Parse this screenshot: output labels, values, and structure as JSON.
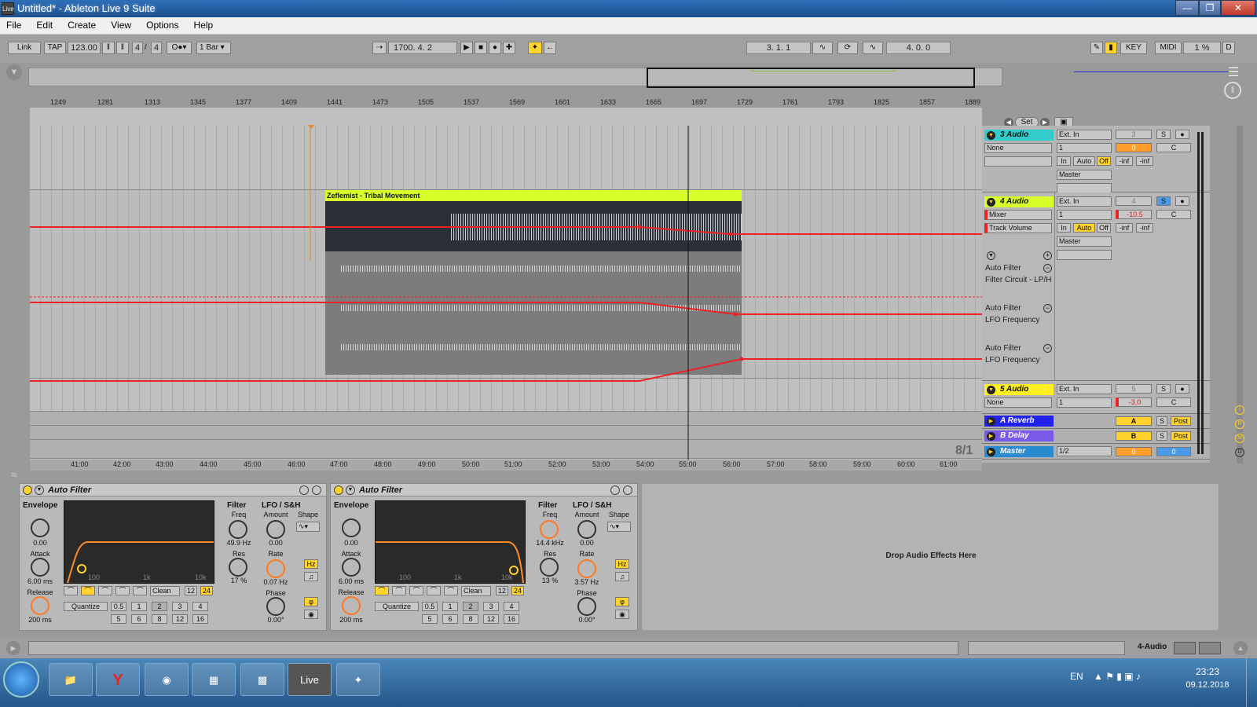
{
  "window": {
    "app_icon": "Live",
    "title": "Untitled* - Ableton Live 9 Suite"
  },
  "menu": [
    "File",
    "Edit",
    "Create",
    "View",
    "Options",
    "Help"
  ],
  "control_bar": {
    "link": "Link",
    "tap": "TAP",
    "tempo": "123.00",
    "signature_num": "4",
    "signature_den": "4",
    "quantize": "1 Bar",
    "position": "1700.   4.   2",
    "loop_start": "3.   1.   1",
    "loop_length": "4.   0.   0",
    "key": "KEY",
    "midi": "MIDI",
    "cpu": "1 %",
    "d": "D"
  },
  "ruler_bars": [
    "1249",
    "1281",
    "1313",
    "1345",
    "1377",
    "1409",
    "1441",
    "1473",
    "1505",
    "1537",
    "1569",
    "1601",
    "1633",
    "1665",
    "1697",
    "1729",
    "1761",
    "1793",
    "1825",
    "1857",
    "1889"
  ],
  "time_ruler": [
    "41:00",
    "42:00",
    "43:00",
    "44:00",
    "45:00",
    "46:00",
    "47:00",
    "48:00",
    "49:00",
    "50:00",
    "51:00",
    "52:00",
    "53:00",
    "54:00",
    "55:00",
    "56:00",
    "57:00",
    "58:00",
    "59:00",
    "60:00",
    "61:00"
  ],
  "grid_label": "8/1",
  "locators": {
    "set": "Set"
  },
  "clip": {
    "name": "Zeflemist - Tribal Movement",
    "color": "#d8ff2a"
  },
  "tracks": [
    {
      "name": "3 Audio",
      "color": "#33cccc",
      "input": "Ext. In",
      "channel": "1",
      "route": "None",
      "output": "Master",
      "number": "3",
      "volume": "0",
      "pan": "C",
      "solo": "S",
      "monitor_in": "In",
      "monitor_auto": "Auto",
      "monitor_off": "Off",
      "inf1": "-inf",
      "inf2": "-inf"
    },
    {
      "name": "4 Audio",
      "color": "#d8ff2a",
      "input": "Ext. In",
      "channel": "1",
      "route": "Mixer",
      "automation": "Track Volume",
      "output": "Master",
      "number": "4",
      "volume": "-10.5",
      "pan": "C",
      "solo": "S",
      "monitor_in": "In",
      "monitor_auto": "Auto",
      "monitor_off": "Off",
      "inf1": "-inf",
      "inf2": "-inf",
      "lanes": [
        {
          "device": "Auto Filter",
          "param": "Filter Circuit - LP/H"
        },
        {
          "device": "Auto Filter",
          "param": "LFO Frequency"
        },
        {
          "device": "Auto Filter",
          "param": "LFO Frequency"
        }
      ]
    },
    {
      "name": "5 Audio",
      "color": "#ffee22",
      "input": "Ext. In",
      "channel": "1",
      "route": "None",
      "number": "5",
      "volume": "-3.0",
      "pan": "C",
      "solo": "S"
    }
  ],
  "returns": [
    {
      "name": "A Reverb",
      "color": "#2222ee",
      "letter": "A",
      "solo": "S",
      "post": "Post"
    },
    {
      "name": "B Delay",
      "color": "#7a5ae8",
      "letter": "B",
      "solo": "S",
      "post": "Post"
    }
  ],
  "master": {
    "name": "Master",
    "color": "#2a8ad0",
    "output": "1/2",
    "volume": "0",
    "cue": "0"
  },
  "devices": [
    {
      "name": "Auto Filter",
      "envelope": "Envelope",
      "env_val": "0.00",
      "attack": "Attack",
      "attack_val": "6.00 ms",
      "release": "Release",
      "release_val": "200 ms",
      "filter": "Filter",
      "freq": "Freq",
      "freq_val": "49.9 Hz",
      "res": "Res",
      "res_val": "17 %",
      "lfo": "LFO / S&H",
      "amount": "Amount",
      "amount_val": "0.00",
      "shape": "Shape",
      "rate": "Rate",
      "rate_val": "0.07 Hz",
      "phase": "Phase",
      "phase_val": "0.00°",
      "circuit": "Clean",
      "slope12": "12",
      "slope24": "24",
      "quantize": "Quantize",
      "hz": "Hz",
      "q_values": [
        "0.5",
        "1",
        "2",
        "3",
        "4",
        "5",
        "6",
        "8",
        "12",
        "16"
      ],
      "graph_labels": [
        "100",
        "1k",
        "10k"
      ],
      "cutoff_fraction": 0.12
    },
    {
      "name": "Auto Filter",
      "envelope": "Envelope",
      "env_val": "0.00",
      "attack": "Attack",
      "attack_val": "6.00 ms",
      "release": "Release",
      "release_val": "200 ms",
      "filter": "Filter",
      "freq": "Freq",
      "freq_val": "14.4 kHz",
      "res": "Res",
      "res_val": "13 %",
      "lfo": "LFO / S&H",
      "amount": "Amount",
      "amount_val": "0.00",
      "shape": "Shape",
      "rate": "Rate",
      "rate_val": "3.57 Hz",
      "phase": "Phase",
      "phase_val": "0.00°",
      "circuit": "Clean",
      "slope12": "12",
      "slope24": "24",
      "quantize": "Quantize",
      "hz": "Hz",
      "q_values": [
        "0.5",
        "1",
        "2",
        "3",
        "4",
        "5",
        "6",
        "8",
        "12",
        "16"
      ],
      "graph_labels": [
        "100",
        "1k",
        "10k"
      ],
      "cutoff_fraction": 0.92
    }
  ],
  "drop_text": "Drop Audio Effects Here",
  "status": {
    "track_label": "4-Audio"
  },
  "taskbar": {
    "lang": "EN",
    "time": "23:23",
    "date": "09.12.2018",
    "live_label": "Live"
  }
}
